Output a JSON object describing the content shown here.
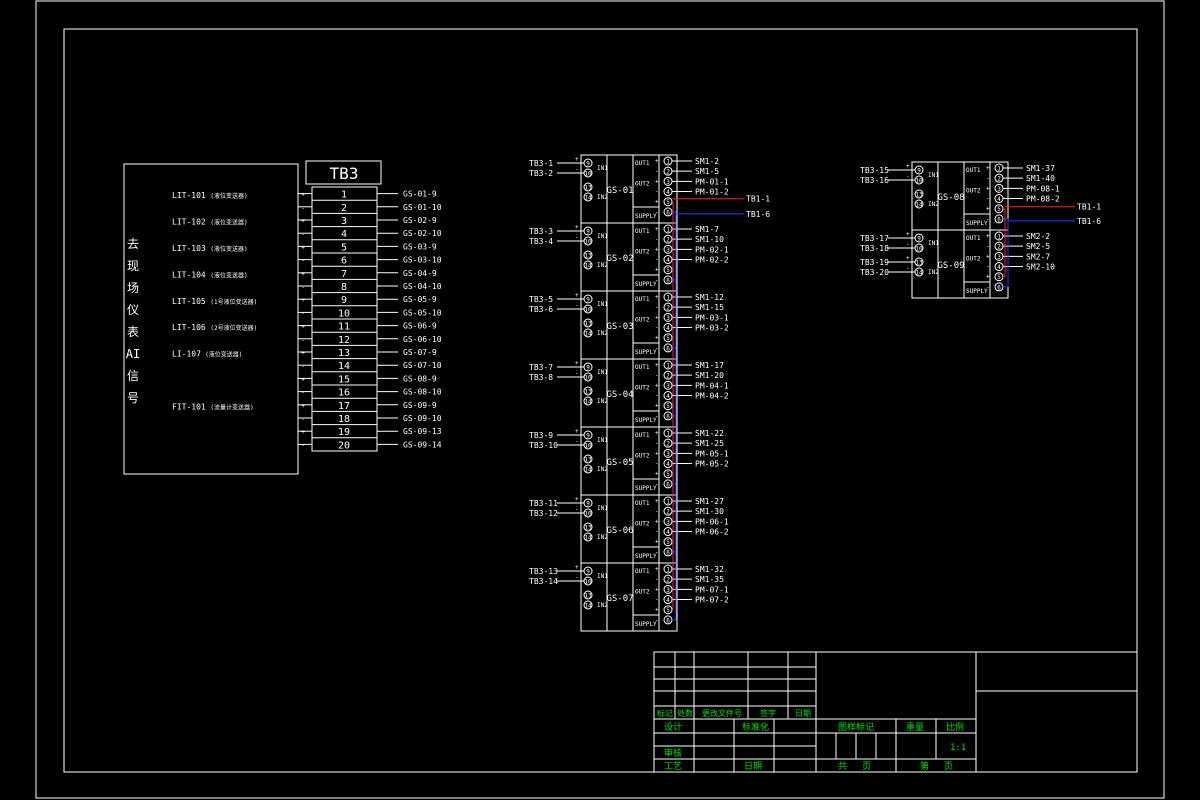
{
  "tb3": {
    "title": "TB3",
    "vertical_label": [
      "去",
      "现",
      "场",
      "仪",
      "表",
      "AI",
      "信",
      "号"
    ],
    "instruments": [
      {
        "tag": "LIT-101",
        "desc": "(液位变送器)",
        "row": 1
      },
      {
        "tag": "LIT-102",
        "desc": "(液位变送器)",
        "row": 3
      },
      {
        "tag": "LIT-103",
        "desc": "(液位变送器)",
        "row": 5
      },
      {
        "tag": "LIT-104",
        "desc": "(液位变送器)",
        "row": 7
      },
      {
        "tag": "LIT-105",
        "desc": "(1号液位变送器)",
        "row": 9
      },
      {
        "tag": "LIT-106",
        "desc": "(2号液位变送器)",
        "row": 11
      },
      {
        "tag": "LI-107",
        "desc": "(液位变送器)",
        "row": 13
      },
      {
        "tag": "FIT-101",
        "desc": "(流量计变送器)",
        "row": 17
      }
    ],
    "terminals": [
      "1",
      "2",
      "3",
      "4",
      "5",
      "6",
      "7",
      "8",
      "9",
      "10",
      "11",
      "12",
      "13",
      "14",
      "15",
      "16",
      "17",
      "18",
      "19",
      "20"
    ],
    "wires": [
      "GS-01-9",
      "GS-01-10",
      "GS-02-9",
      "GS-02-10",
      "GS-03-9",
      "GS-03-10",
      "GS-04-9",
      "GS-04-10",
      "GS-05-9",
      "GS-05-10",
      "GS-06-9",
      "GS-06-10",
      "GS-07-9",
      "GS-07-10",
      "GS-08-9",
      "GS-08-10",
      "GS-09-9",
      "GS-09-10",
      "GS-09-13",
      "GS-09-14"
    ]
  },
  "modules": [
    {
      "id": "GS-01",
      "in": [
        "TB3-1",
        "TB3-2"
      ],
      "out": [
        "SM1-2",
        "SM1-5",
        "PM-01-1",
        "PM-01-2"
      ]
    },
    {
      "id": "GS-02",
      "in": [
        "TB3-3",
        "TB3-4"
      ],
      "out": [
        "SM1-7",
        "SM1-10",
        "PM-02-1",
        "PM-02-2"
      ]
    },
    {
      "id": "GS-03",
      "in": [
        "TB3-5",
        "TB3-6"
      ],
      "out": [
        "SM1-12",
        "SM1-15",
        "PM-03-1",
        "PM-03-2"
      ]
    },
    {
      "id": "GS-04",
      "in": [
        "TB3-7",
        "TB3-8"
      ],
      "out": [
        "SM1-17",
        "SM1-20",
        "PM-04-1",
        "PM-04-2"
      ]
    },
    {
      "id": "GS-05",
      "in": [
        "TB3-9",
        "TB3-10"
      ],
      "out": [
        "SM1-22",
        "SM1-25",
        "PM-05-1",
        "PM-05-2"
      ]
    },
    {
      "id": "GS-06",
      "in": [
        "TB3-11",
        "TB3-12"
      ],
      "out": [
        "SM1-27",
        "SM1-30",
        "PM-06-1",
        "PM-06-2"
      ]
    },
    {
      "id": "GS-07",
      "in": [
        "TB3-13",
        "TB3-14"
      ],
      "out": [
        "SM1-32",
        "SM1-35",
        "PM-07-1",
        "PM-07-2"
      ]
    }
  ],
  "modules_right": [
    {
      "id": "GS-08",
      "in": [
        "TB3-15",
        "TB3-16"
      ],
      "out": [
        "SM1-37",
        "SM1-40",
        "PM-08-1",
        "PM-08-2"
      ]
    },
    {
      "id": "GS-09",
      "in": [
        "TB3-17",
        "TB3-18",
        "TB3-19",
        "TB3-20"
      ],
      "out": [
        "SM2-2",
        "SM2-5",
        "SM2-7",
        "SM2-10"
      ]
    }
  ],
  "module_labels": {
    "in1": "IN1",
    "in2": "IN2",
    "out1": "OUT1",
    "out2": "OUT2",
    "supply": "SUPPLY"
  },
  "terminal_numbers": [
    "9",
    "10",
    "13",
    "14",
    "1",
    "2",
    "3",
    "4",
    "5",
    "6"
  ],
  "power": [
    "TB1-1",
    "TB1-6"
  ],
  "title_block": {
    "row_labels": [
      "标记",
      "处数",
      "更改文件号",
      "签字",
      "日期"
    ],
    "design": "设计",
    "standardize": "标准化",
    "check": "审核",
    "process": "工艺",
    "date": "日期",
    "drawing_mark": "图样标记",
    "weight": "重量",
    "scale_label": "比例",
    "scale": "1:1",
    "total": "共",
    "sheet": "第",
    "page": "页"
  },
  "colors": {
    "background": "#000000",
    "line": "#ffffff",
    "red": "#ff2020",
    "blue": "#2a3cff",
    "green": "#00e000",
    "frame": "#ffffff"
  }
}
